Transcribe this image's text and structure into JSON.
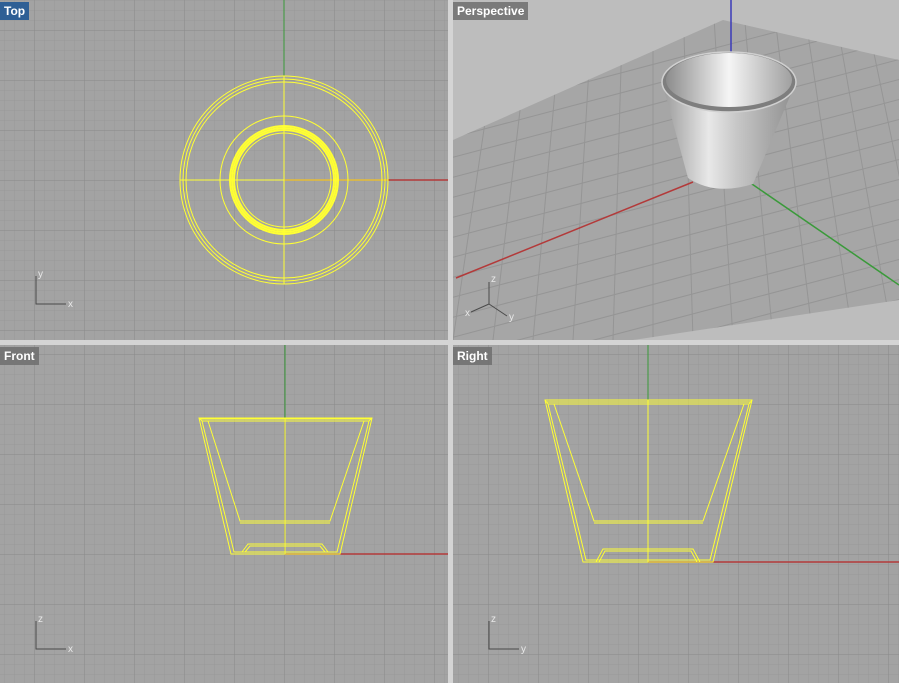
{
  "viewports": {
    "top": {
      "title": "Top",
      "axis_labels": {
        "h": "x",
        "v": "y"
      }
    },
    "perspective": {
      "title": "Perspective",
      "axis_labels": {
        "x": "x",
        "y": "y",
        "z": "z"
      }
    },
    "front": {
      "title": "Front",
      "axis_labels": {
        "h": "x",
        "v": "z"
      }
    },
    "right": {
      "title": "Right",
      "axis_labels": {
        "h": "y",
        "v": "z"
      }
    }
  },
  "colors": {
    "background": "#a3a3a3",
    "grid_minor": "#9a9a9a",
    "grid_major": "#8e8e8e",
    "selection": "#ffff33",
    "x_axis": "#b33a3a",
    "y_axis": "#3a9a3a",
    "z_axis": "#3a3ab8",
    "active_tab": "#2e5f95"
  },
  "active_viewport": "top"
}
